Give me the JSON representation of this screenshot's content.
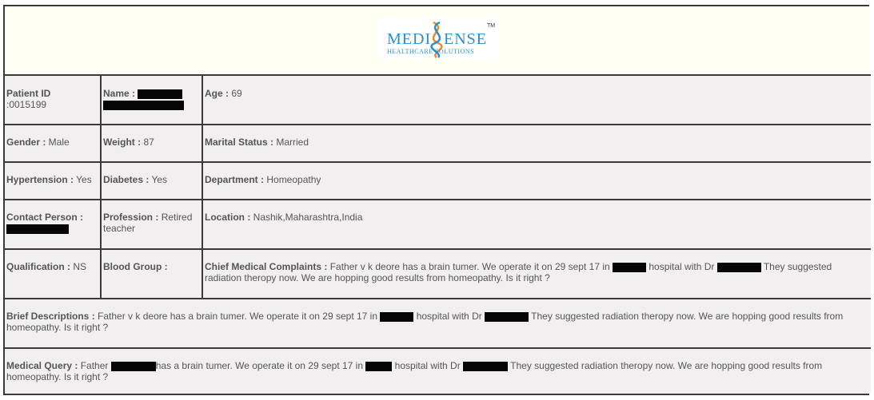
{
  "logo": {
    "brand_left": "MEDI",
    "brand_right": "ENSE",
    "tagline": "HEALTHCARE SOLUTIONS",
    "trademark": "TM",
    "colors": {
      "brand": "#2a8fd0",
      "helix_orange": "#f08a24",
      "helix_blue": "#2a8fd0"
    }
  },
  "patient": {
    "id_label": "Patient ID",
    "id_value": ":0015199",
    "name_label": "Name :",
    "age_label": "Age :",
    "age_value": " 69",
    "gender_label": "Gender :",
    "gender_value": " Male",
    "weight_label": "Weight :",
    "weight_value": " 87",
    "marital_label": "Marital Status :",
    "marital_value": " Married",
    "hypertension_label": "Hypertension :",
    "hypertension_value": " Yes",
    "diabetes_label": "Diabetes :",
    "diabetes_value": " Yes",
    "department_label": "Department :",
    "department_value": " Homeopathy",
    "contact_label": "Contact Person :",
    "profession_label": "Profession :",
    "profession_value": " Retired teacher",
    "location_label": "Location :",
    "location_value": " Nashik,Maharashtra,India",
    "qualification_label": "Qualification :",
    "qualification_value": " NS",
    "blood_group_label": "Blood Group :"
  },
  "complaints": {
    "label": "Chief Medical Complaints :",
    "part1": " Father v k deore has a brain tumer. We operate it on 29 sept 17 in ",
    "part2": " hospital with Dr ",
    "part3": " They suggested radiation theropy now. We are hopping good results from homeopathy. Is it right ?"
  },
  "brief": {
    "label": "Brief Descriptions :",
    "part1": " Father v k deore has a brain tumer. We operate it on 29 sept 17 in ",
    "part2": " hospital with Dr ",
    "part3": " They suggested radiation theropy now. We are hopping good results from homeopathy. Is it right ?"
  },
  "query": {
    "label": "Medical Query :",
    "part1": " Father ",
    "part2": "has a brain tumer. We operate it on 29 sept 17 in ",
    "part3": " hospital with Dr ",
    "part4": " They suggested radiation theropy now. We are hopping good results from homeopathy. Is it right ?"
  }
}
